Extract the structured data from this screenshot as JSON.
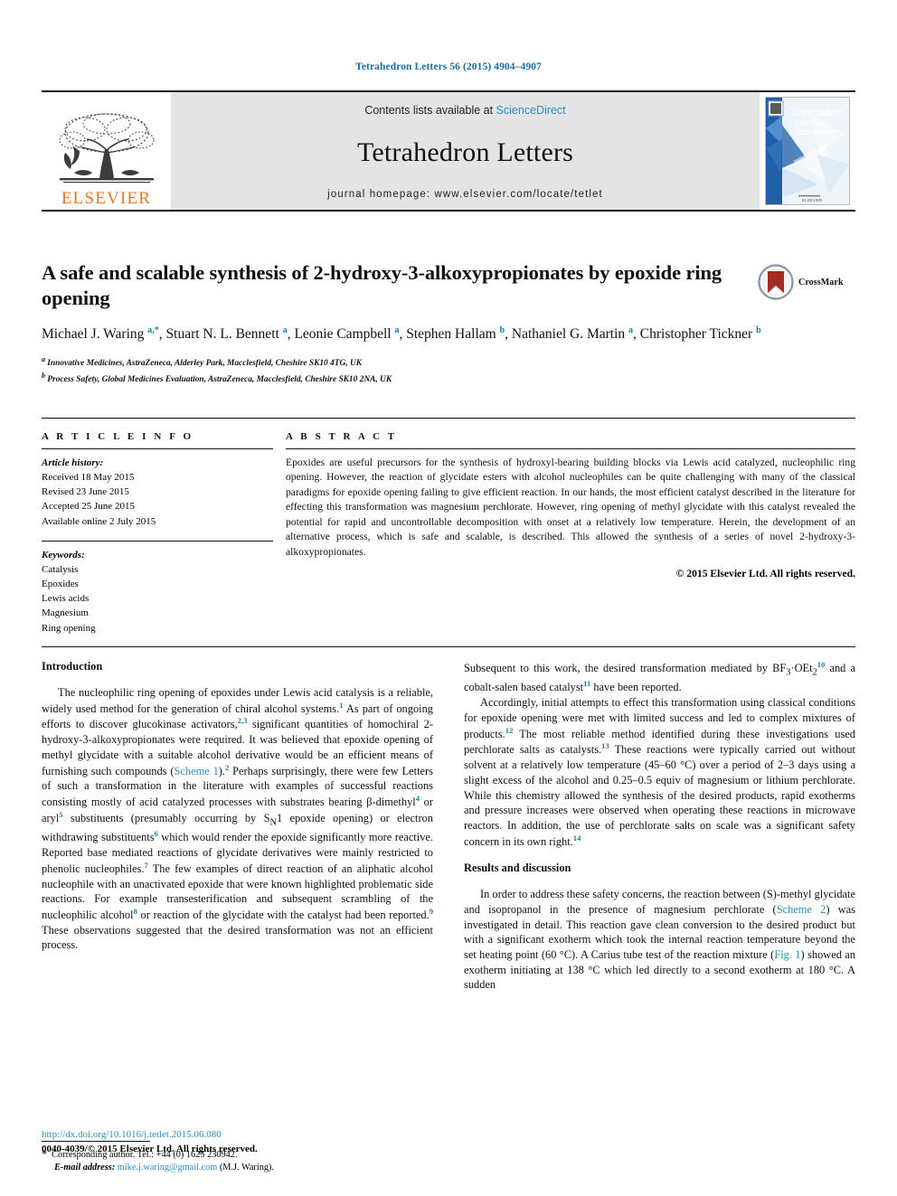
{
  "running_head": "Tetrahedron Letters 56 (2015) 4904–4907",
  "masthead": {
    "contents_prefix": "Contents lists available at ",
    "sciencedirect": "ScienceDirect",
    "journal_name": "Tetrahedron Letters",
    "homepage": "journal homepage: www.elsevier.com/locate/tetlet",
    "publisher_word": "ELSEVIER",
    "cover_title_line1": "Tetrahedron",
    "cover_title_line2": "Letters",
    "accent_blue": "#2a8fc4",
    "elsevier_orange": "#e87722"
  },
  "article": {
    "title": "A safe and scalable synthesis of 2-hydroxy-3-alkoxypropionates by epoxide ring opening",
    "crossmark_label": "CrossMark",
    "authors_html": "Michael J. Waring <sup>a,*</sup>, Stuart N. L. Bennett <sup>a</sup>, Leonie Campbell <sup>a</sup>, Stephen Hallam <sup>b</sup>, Nathaniel G. Martin <sup>a</sup>, Christopher Tickner <sup>b</sup>",
    "affiliation_a": "Innovative Medicines, AstraZeneca, Alderley Park, Macclesfield, Cheshire SK10 4TG, UK",
    "affiliation_b": "Process Safety, Global Medicines Evaluation, AstraZeneca, Macclesfield, Cheshire SK10 2NA, UK"
  },
  "article_info": {
    "heading": "A R T I C L E    I N F O",
    "history_label": "Article history:",
    "history": [
      "Received 18 May 2015",
      "Revised 23 June 2015",
      "Accepted 25 June 2015",
      "Available online 2 July 2015"
    ],
    "keywords_label": "Keywords:",
    "keywords": [
      "Catalysis",
      "Epoxides",
      "Lewis acids",
      "Magnesium",
      "Ring opening"
    ]
  },
  "abstract": {
    "heading": "A B S T R A C T",
    "text": "Epoxides are useful precursors for the synthesis of hydroxyl-bearing building blocks via Lewis acid catalyzed, nucleophilic ring opening. However, the reaction of glycidate esters with alcohol nucleophiles can be quite challenging with many of the classical paradigms for epoxide opening failing to give efficient reaction. In our hands, the most efficient catalyst described in the literature for effecting this transformation was magnesium perchlorate. However, ring opening of methyl glycidate with this catalyst revealed the potential for rapid and uncontrollable decomposition with onset at a relatively low temperature. Herein, the development of an alternative process, which is safe and scalable, is described. This allowed the synthesis of a series of novel 2-hydroxy-3-alkoxypropionates.",
    "copyright": "© 2015 Elsevier Ltd. All rights reserved."
  },
  "body": {
    "intro_heading": "Introduction",
    "intro_p1_html": "The nucleophilic ring opening of epoxides under Lewis acid catalysis is a reliable, widely used method for the generation of chiral alcohol systems.<sup class=\"ref\">1</sup> As part of ongoing efforts to discover glucokinase activators,<sup class=\"ref\">2,3</sup> significant quantities of homochiral 2-hydroxy-3-alkoxypropionates were required. It was believed that epoxide opening of methyl glycidate with a suitable alcohol derivative would be an efficient means of furnishing such compounds (<span class=\"lnk\">Scheme 1</span>).<sup class=\"ref\">2</sup> Perhaps surprisingly, there were few Letters of such a transformation in the literature with examples of successful reactions consisting mostly of acid catalyzed processes with substrates bearing β-dimethyl<sup class=\"ref\">4</sup> or aryl<sup class=\"ref\">5</sup> substituents (presumably occurring by S<sub>N</sub>1 epoxide opening) or electron withdrawing substituents<sup class=\"ref\">6</sup> which would render the epoxide significantly more reactive. Reported base mediated reactions of glycidate derivatives were mainly restricted to phenolic nucleophiles.<sup class=\"ref\">7</sup> The few examples of direct reaction of an aliphatic alcohol nucleophile with an unactivated epoxide that were known highlighted problematic side reactions. For example transesterification and subsequent scrambling of the nucleophilic alcohol<sup class=\"ref\">8</sup> or reaction of the glycidate with the catalyst had been reported.<sup class=\"ref\">9</sup> These observations suggested that the desired transformation was not an efficient process.",
    "right_p1_html": "Subsequent to this work, the desired transformation mediated by BF<sub>3</sub>·OEt<sub>2</sub><sup class=\"ref\">10</sup> and a cobalt-salen based catalyst<sup class=\"ref\">11</sup> have been reported.",
    "right_p2_html": "Accordingly, initial attempts to effect this transformation using classical conditions for epoxide opening were met with limited success and led to complex mixtures of products.<sup class=\"ref\">12</sup> The most reliable method identified during these investigations used perchlorate salts as catalysts.<sup class=\"ref\">13</sup> These reactions were typically carried out without solvent at a relatively low temperature (45–60 °C) over a period of 2–3 days using a slight excess of the alcohol and 0.25–0.5 equiv of magnesium or lithium perchlorate. While this chemistry allowed the synthesis of the desired products, rapid exotherms and pressure increases were observed when operating these reactions in microwave reactors. In addition, the use of perchlorate salts on scale was a significant safety concern in its own right.<sup class=\"ref\">14</sup>",
    "results_heading": "Results and discussion",
    "results_p1_html": "In order to address these safety concerns, the reaction between (S)-methyl glycidate and isopropanol in the presence of magnesium perchlorate (<span class=\"lnk\">Scheme 2</span>) was investigated in detail. This reaction gave clean conversion to the desired product but with a significant exotherm which took the internal reaction temperature beyond the set heating point (60 °C). A Carius tube test of the reaction mixture (<span class=\"lnk\">Fig. 1</span>) showed an exotherm initiating at 138 °C which led directly to a second exotherm at 180 °C. A sudden"
  },
  "footnote": {
    "corresponding_html": "<span style=\"font-size:12px\">*</span>&nbsp; Corresponding author. Tel.: +44 (0) 1625 230942.",
    "email_label": "E-mail address:",
    "email": "mike.j.waring@gmail.com",
    "email_owner": "(M.J. Waring)."
  },
  "footer": {
    "doi": "http://dx.doi.org/10.1016/j.tetlet.2015.06.080",
    "issn_line": "0040-4039/© 2015 Elsevier Ltd. All rights reserved."
  }
}
